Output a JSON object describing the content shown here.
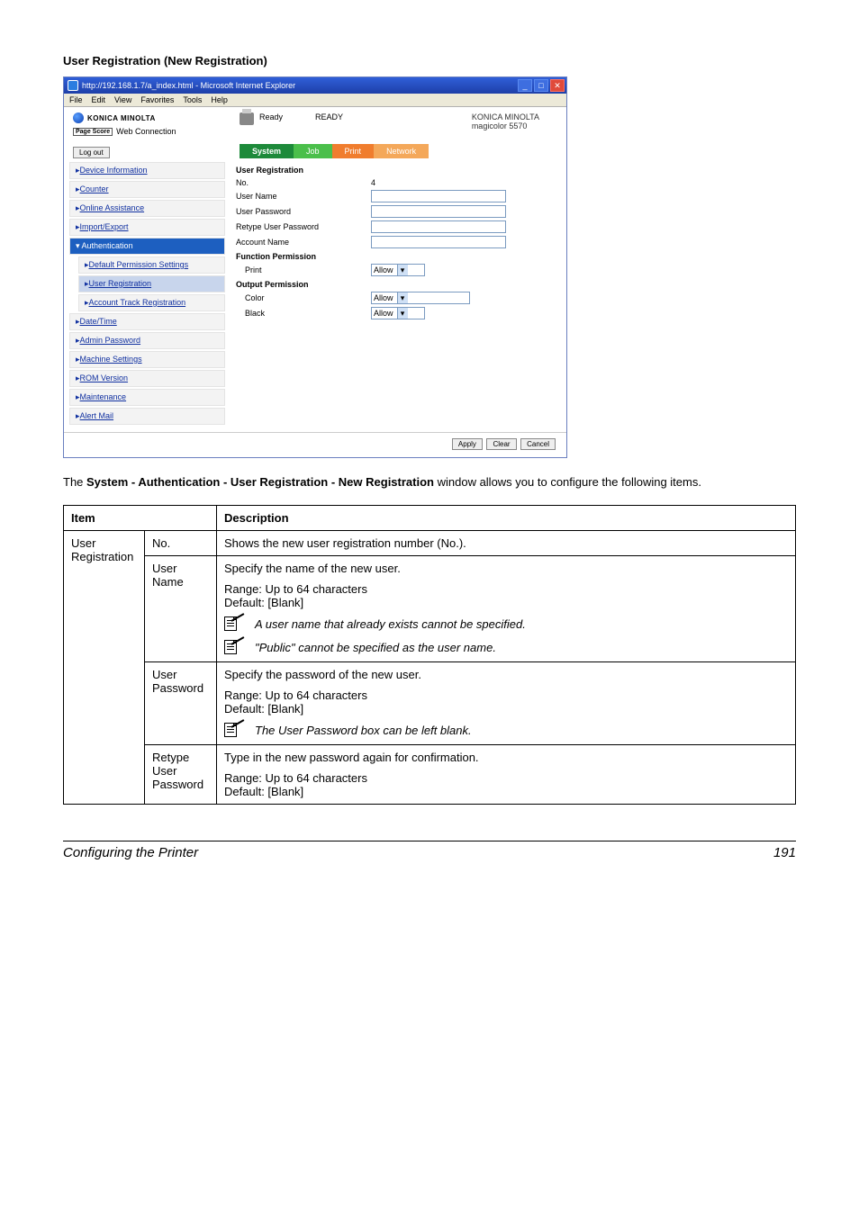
{
  "section_heading": "User Registration (New Registration)",
  "browser": {
    "title": "http://192.168.1.7/a_index.html - Microsoft Internet Explorer",
    "menus": [
      "File",
      "Edit",
      "View",
      "Favorites",
      "Tools",
      "Help"
    ],
    "brand_main": "KONICA MINOLTA",
    "brand_sub_prefix": "Page Score",
    "brand_sub": "Web Connection",
    "ready_label": "Ready",
    "ready_status": "READY",
    "right_brand_line1": "KONICA MINOLTA",
    "right_brand_line2": "magicolor 5570",
    "logout": "Log out",
    "tabs": [
      "System",
      "Job",
      "Print",
      "Network"
    ],
    "sidebar": [
      "Device Information",
      "Counter",
      "Online Assistance",
      "Import/Export",
      "Authentication",
      "Default Permission Settings",
      "User Registration",
      "Account Track Registration",
      "Date/Time",
      "Admin Password",
      "Machine Settings",
      "ROM Version",
      "Maintenance",
      "Alert Mail"
    ],
    "panel": {
      "title": "User Registration",
      "no_label": "No.",
      "no_value": "4",
      "username_label": "User Name",
      "userpass_label": "User Password",
      "retype_label": "Retype User Password",
      "account_label": "Account Name",
      "func_perm": "Function Permission",
      "print_label": "Print",
      "print_value": "Allow",
      "out_perm": "Output Permission",
      "color_label": "Color",
      "color_value": "Allow",
      "black_label": "Black",
      "black_value": "Allow",
      "buttons": [
        "Apply",
        "Clear",
        "Cancel"
      ]
    }
  },
  "paragraph_prefix": "The ",
  "paragraph_bold": "System - Authentication - User Registration - New Registration",
  "paragraph_suffix": " window allows you to configure the following items.",
  "table": {
    "headers": [
      "Item",
      "Description"
    ],
    "group_label": "User Registration",
    "rows": {
      "no": {
        "label": "No.",
        "desc": "Shows the new user registration number (No.)."
      },
      "username": {
        "label": "User Name",
        "desc_line1": "Specify the name of the new user.",
        "range": "Range:   Up to 64 characters",
        "default": "Default:  [Blank]",
        "note1": "A user name that already exists cannot be specified.",
        "note2": "\"Public\" cannot be specified as the user name."
      },
      "userpass": {
        "label": "User Password",
        "desc_line1": "Specify the password of the new user.",
        "range": "Range:   Up to 64 characters",
        "default": "Default:  [Blank]",
        "note1": "The User Password box can be left blank."
      },
      "retype": {
        "label": "Retype User Password",
        "desc_line1": "Type in the new password again for confirmation.",
        "range": "Range:   Up to 64 characters",
        "default": "Default:  [Blank]"
      }
    }
  },
  "footer": {
    "left": "Configuring the Printer",
    "right": "191"
  }
}
